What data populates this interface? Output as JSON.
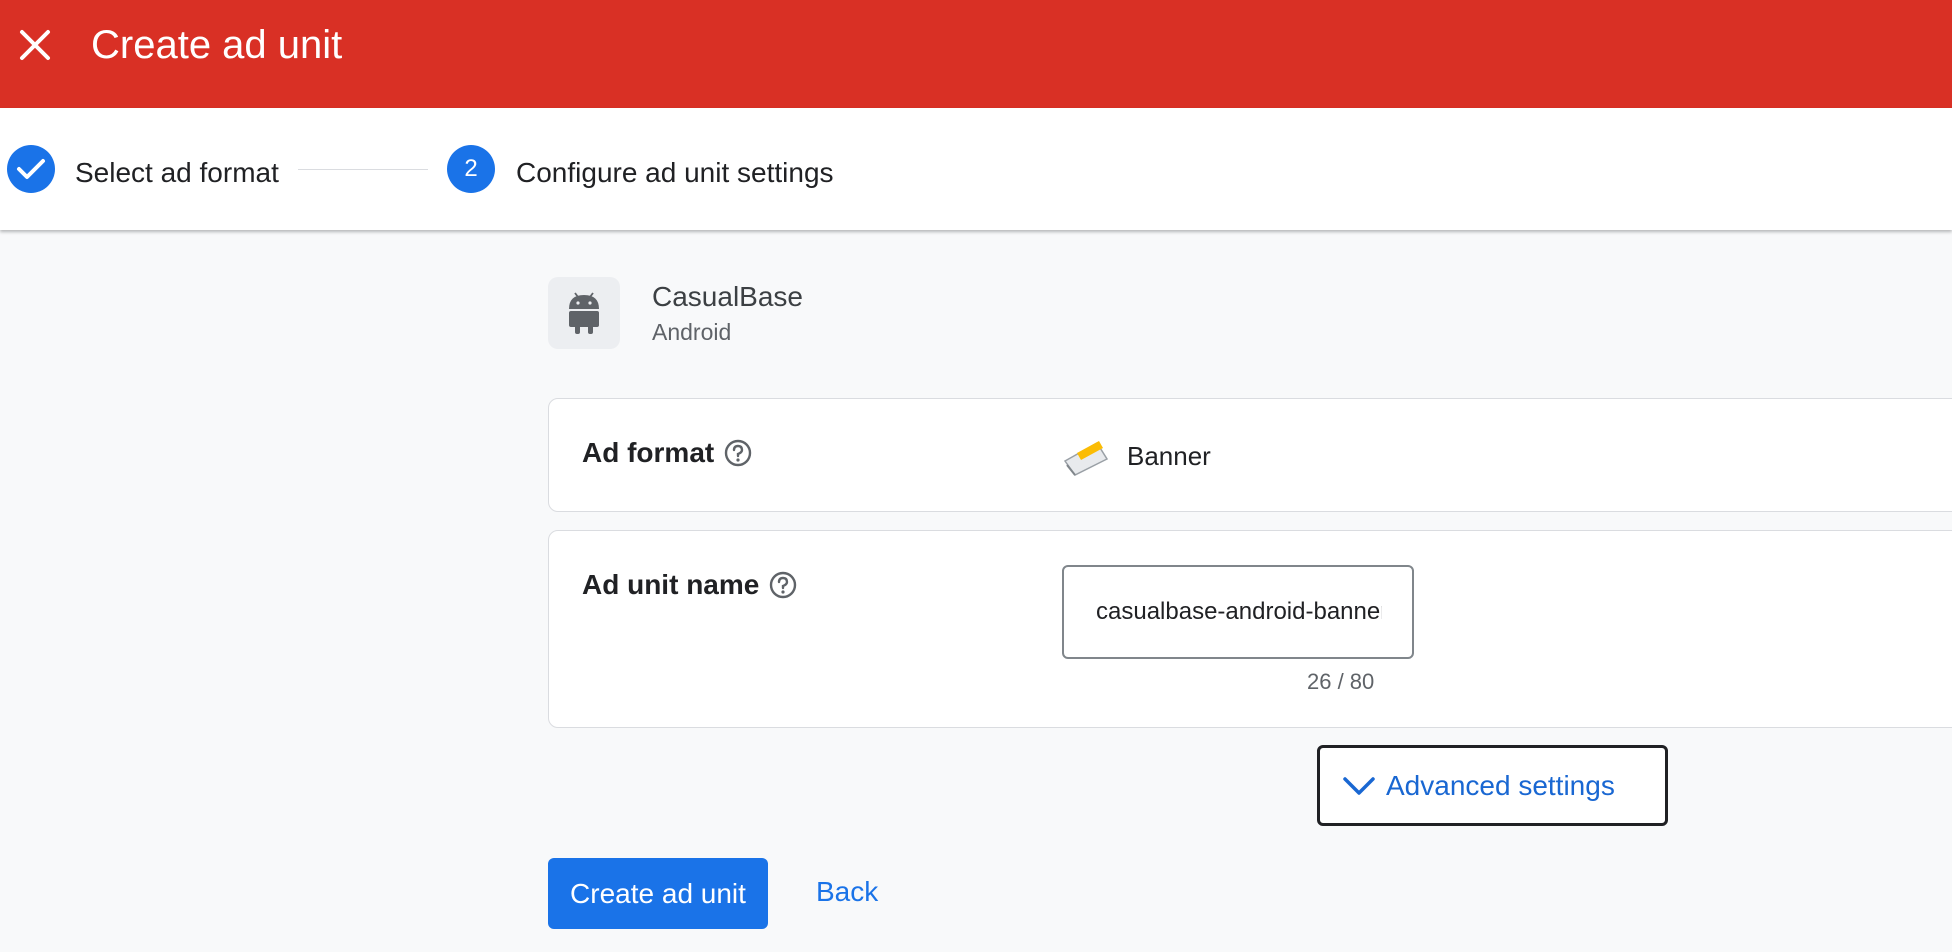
{
  "header": {
    "title": "Create ad unit",
    "close_icon": "close-icon",
    "background": "#d93025"
  },
  "stepper": {
    "steps": [
      {
        "label": "Select ad format",
        "status": "completed",
        "icon": "check-icon"
      },
      {
        "label": "Configure ad unit settings",
        "status": "active",
        "number": "2"
      }
    ],
    "accent": "#1a73e8"
  },
  "app": {
    "name": "CasualBase",
    "platform": "Android",
    "icon": "android-icon"
  },
  "ad_format": {
    "label": "Ad format",
    "help_icon": "help-icon",
    "value": "Banner",
    "value_icon": "banner-icon"
  },
  "ad_unit_name": {
    "label": "Ad unit name",
    "help_icon": "help-icon",
    "value": "casualbase-android-banner",
    "char_count": "26 / 80"
  },
  "advanced": {
    "label": "Advanced settings",
    "icon": "chevron-down-icon"
  },
  "actions": {
    "create_label": "Create ad unit",
    "back_label": "Back"
  }
}
